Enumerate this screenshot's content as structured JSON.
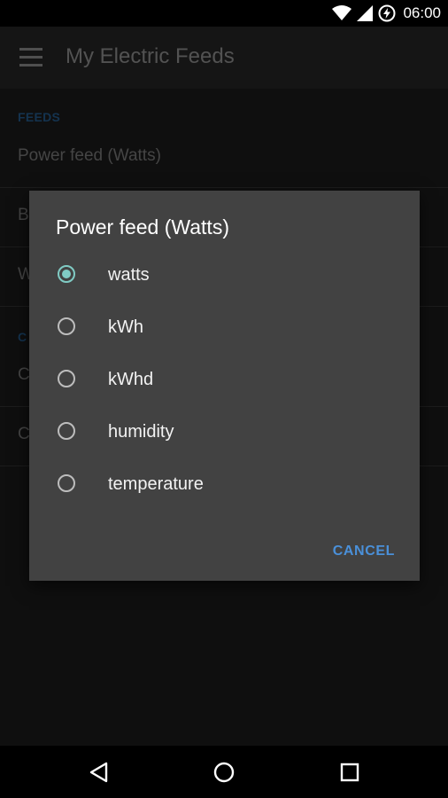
{
  "status_bar": {
    "time": "06:00"
  },
  "app_bar": {
    "title": "My Electric Feeds"
  },
  "settings": {
    "section_feeds": "FEEDS",
    "power_feed_label": "Power feed (Watts)",
    "item2_initial": "B",
    "item3_initial": "W",
    "section2_initial": "C",
    "item4_initial": "C",
    "item5_initial": "C"
  },
  "dialog": {
    "title": "Power feed (Watts)",
    "options": [
      {
        "label": "watts",
        "checked": true
      },
      {
        "label": "kWh",
        "checked": false
      },
      {
        "label": "kWhd",
        "checked": false
      },
      {
        "label": "humidity",
        "checked": false
      },
      {
        "label": "temperature",
        "checked": false
      }
    ],
    "cancel_label": "CANCEL"
  },
  "colors": {
    "accent": "#80cbc4",
    "button": "#4a90d9",
    "section_header": "#1f4f7a"
  }
}
